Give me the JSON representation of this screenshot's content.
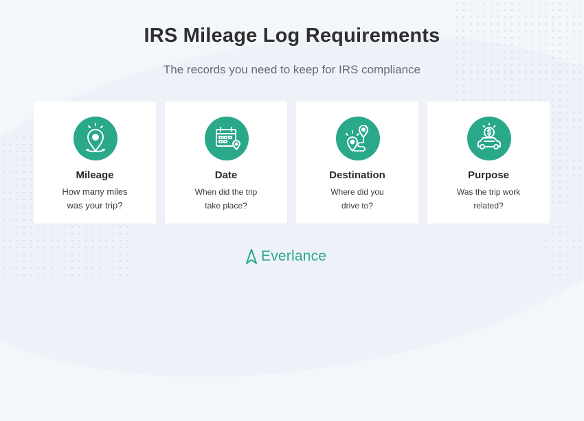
{
  "title": "IRS Mileage Log Requirements",
  "subtitle": "The records you need to keep for IRS compliance",
  "cards": [
    {
      "title": "Mileage",
      "line1": "How many miles",
      "line2": "was your trip?",
      "icon": "location-pin-icon"
    },
    {
      "title": "Date",
      "line1": "When did the trip",
      "line2": "take place?",
      "icon": "calendar-icon"
    },
    {
      "title": "Destination",
      "line1": "Where did you",
      "line2": "drive to?",
      "icon": "route-icon"
    },
    {
      "title": "Purpose",
      "line1": "Was the trip work",
      "line2": "related?",
      "icon": "car-dollar-icon"
    }
  ],
  "brand": {
    "name": "Everlance",
    "color": "#2aa88a"
  }
}
